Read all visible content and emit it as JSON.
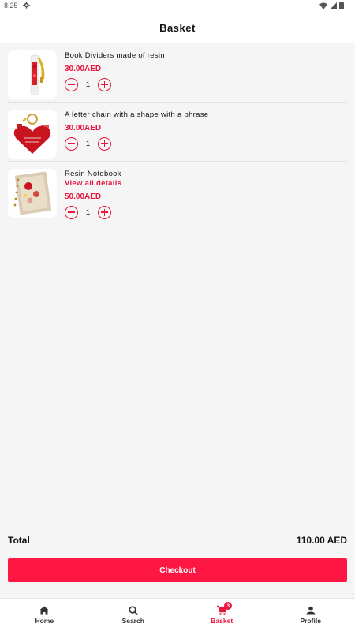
{
  "status_bar": {
    "time": "8:25"
  },
  "header": {
    "title": "Basket"
  },
  "items": [
    {
      "name": "Book Dividers made of resin",
      "link": "",
      "price": "30.00AED",
      "quantity": "1"
    },
    {
      "name": "A letter chain with a shape with a phrase",
      "link": "",
      "price": "30.00AED",
      "quantity": "1"
    },
    {
      "name": "Resin Notebook",
      "link": "View all details",
      "price": "50.00AED",
      "quantity": "1"
    }
  ],
  "summary": {
    "total_label": "Total",
    "total_value": "110.00 AED"
  },
  "checkout": {
    "label": "Checkout"
  },
  "nav": {
    "home": "Home",
    "search": "Search",
    "basket": "Basket",
    "basket_badge": "3",
    "profile": "Profile"
  },
  "colors": {
    "accent": "#e8163f",
    "button": "#ff1744"
  }
}
